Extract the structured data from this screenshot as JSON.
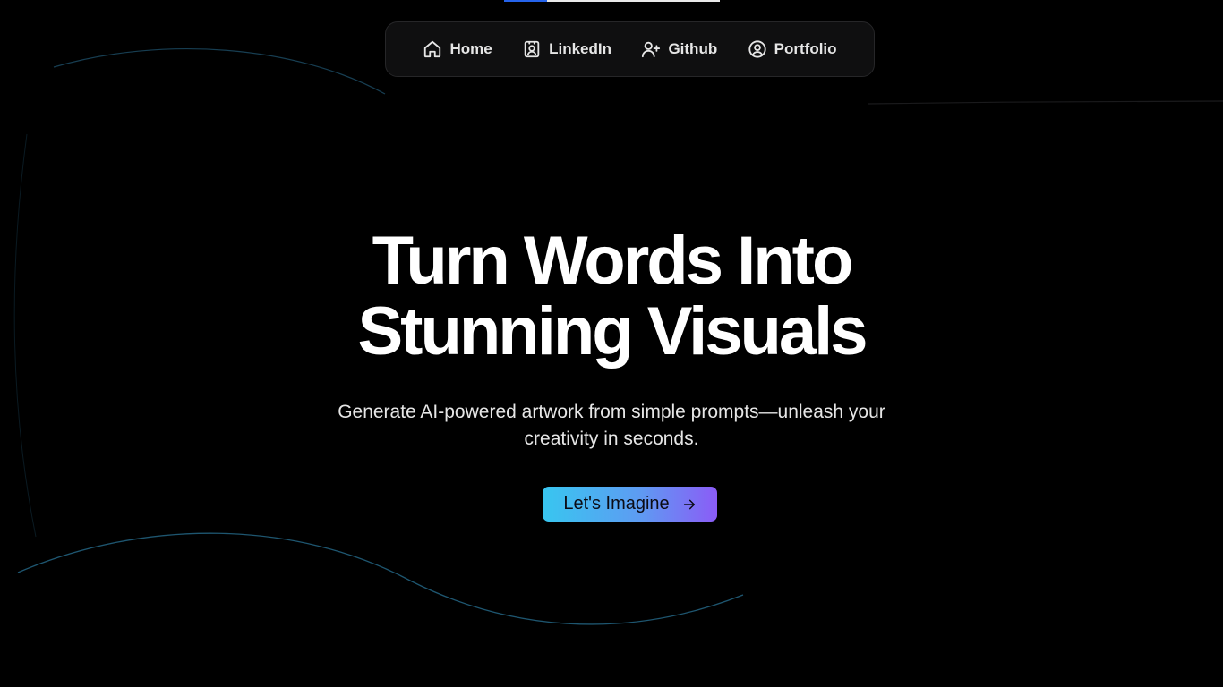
{
  "top_progress": {
    "value": 0.2,
    "fill_color": "#2563eb",
    "track_color": "#e8e8e8"
  },
  "nav": {
    "items": [
      {
        "label": "Home",
        "icon": "home-icon"
      },
      {
        "label": "LinkedIn",
        "icon": "contact-badge-icon"
      },
      {
        "label": "Github",
        "icon": "user-plus-icon"
      },
      {
        "label": "Portfolio",
        "icon": "user-circle-icon"
      }
    ]
  },
  "hero": {
    "title_line1": "Turn Words Into",
    "title_line2": "Stunning Visuals",
    "subtitle_line1": "Generate AI-powered artwork from simple prompts—unleash your",
    "subtitle_line2": "creativity in seconds."
  },
  "cta": {
    "label": "Let's Imagine",
    "icon": "arrow-right-icon",
    "gradient": [
      "#38c6f0",
      "#5d9cf2",
      "#8b5cf6"
    ]
  },
  "colors": {
    "background": "#000000",
    "wave_line": "#1f5d7a",
    "text": "#ffffff"
  }
}
